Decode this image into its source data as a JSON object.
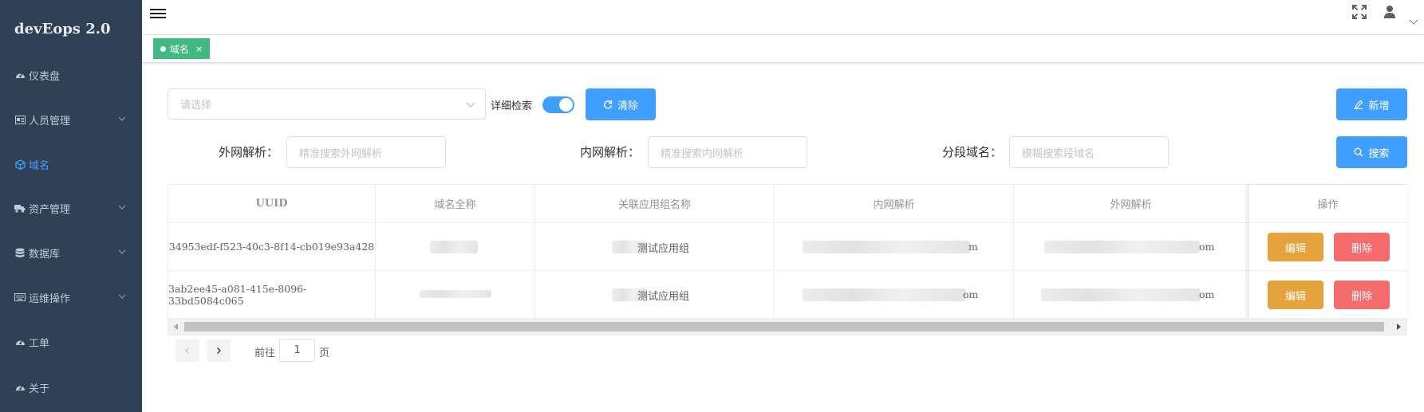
{
  "sidebar": {
    "brand": "devEops 2.0",
    "items": [
      {
        "label": "仪表盘",
        "icon": "dashboard-icon",
        "has_children": false,
        "active": false
      },
      {
        "label": "人员管理",
        "icon": "id-card-icon",
        "has_children": true,
        "active": false
      },
      {
        "label": "域名",
        "icon": "cube-icon",
        "has_children": false,
        "active": true
      },
      {
        "label": "资产管理",
        "icon": "truck-icon",
        "has_children": true,
        "active": false
      },
      {
        "label": "数据库",
        "icon": "database-icon",
        "has_children": true,
        "active": false
      },
      {
        "label": "运维操作",
        "icon": "keyboard-icon",
        "has_children": true,
        "active": false
      },
      {
        "label": "工单",
        "icon": "dashboard-icon",
        "has_children": false,
        "active": false
      },
      {
        "label": "关于",
        "icon": "dashboard-icon",
        "has_children": false,
        "active": false
      }
    ]
  },
  "header": {
    "icons": [
      "hamburger-icon",
      "fullscreen-icon",
      "user-icon",
      "chevron-down-icon"
    ]
  },
  "tags": [
    {
      "label": "域名",
      "close": "×"
    }
  ],
  "filters": {
    "select_placeholder": "请选择",
    "detail_switch_label": "详细检索",
    "detail_switch_on": true,
    "clear_label": "清除",
    "new_label": "新增",
    "search_label": "搜索",
    "external_label": "外网解析：",
    "external_placeholder": "精准搜索外网解析",
    "internal_label": "内网解析：",
    "internal_placeholder": "精准搜索内网解析",
    "segment_label": "分段域名：",
    "segment_placeholder": "模糊搜索段域名"
  },
  "table": {
    "columns": [
      "UUID",
      "域名全称",
      "关联应用组名称",
      "内网解析",
      "外网解析",
      "操作"
    ],
    "rows": [
      {
        "uuid": "34953edf-f523-40c3-8f14-cb019e93a428",
        "app_group_suffix": "测试应用组",
        "internal_suffix": "m",
        "external_suffix": "om"
      },
      {
        "uuid": "3ab2ee45-a081-415e-8096-33bd5084c065",
        "app_group_suffix": "测试应用组",
        "internal_suffix": "om",
        "external_suffix": "om"
      }
    ],
    "edit_label": "编辑",
    "delete_label": "删除"
  },
  "pagination": {
    "goto_label": "前往",
    "page": "1",
    "page_suffix": "页"
  },
  "colors": {
    "sidebar_bg": "#304156",
    "primary": "#409eff",
    "tag": "#42b983",
    "edit": "#e6a23c",
    "delete": "#f56c6c"
  }
}
